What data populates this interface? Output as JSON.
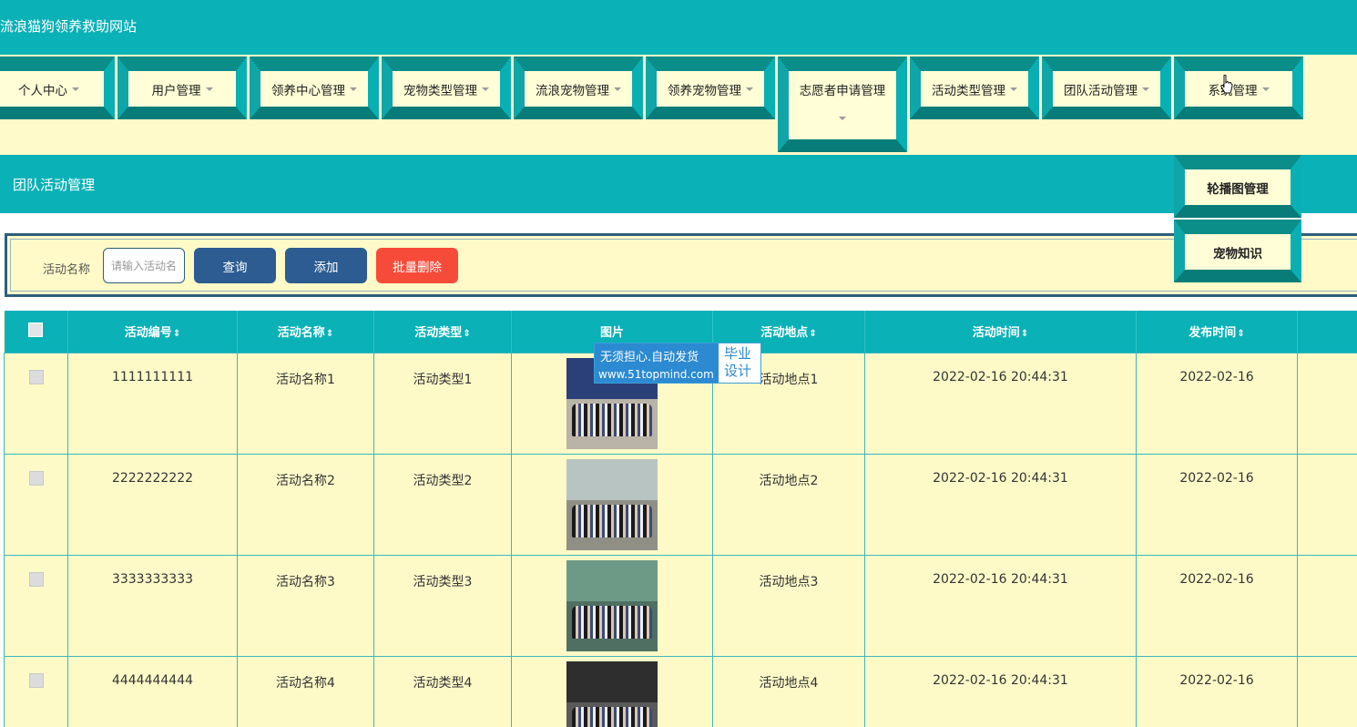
{
  "header": {
    "site_title": "流浪猫狗领养救助网站"
  },
  "nav": {
    "items": [
      {
        "label": "个人中心"
      },
      {
        "label": "用户管理"
      },
      {
        "label": "领养中心管理"
      },
      {
        "label": "宠物类型管理"
      },
      {
        "label": "流浪宠物管理"
      },
      {
        "label": "领养宠物管理"
      },
      {
        "label": "志愿者申请管理"
      },
      {
        "label": "活动类型管理"
      },
      {
        "label": "团队活动管理"
      },
      {
        "label": "系统管理"
      }
    ],
    "dropdown": [
      {
        "label": "轮播图管理"
      },
      {
        "label": "宠物知识"
      }
    ]
  },
  "section": {
    "title": "团队活动管理"
  },
  "search": {
    "label": "活动名称",
    "placeholder": "请输入活动名称",
    "query_button": "查询",
    "add_button": "添加",
    "batch_delete_button": "批量删除"
  },
  "table": {
    "headers": [
      "活动编号",
      "活动名称",
      "活动类型",
      "图片",
      "活动地点",
      "活动时间",
      "发布时间"
    ],
    "sort_glyph": "⇕",
    "rows": [
      {
        "id": "1111111111",
        "name": "活动名称1",
        "type": "活动类型1",
        "location": "活动地点1",
        "time": "2022-02-16 20:44:31",
        "published": "2022-02-16"
      },
      {
        "id": "2222222222",
        "name": "活动名称2",
        "type": "活动类型2",
        "location": "活动地点2",
        "time": "2022-02-16 20:44:31",
        "published": "2022-02-16"
      },
      {
        "id": "3333333333",
        "name": "活动名称3",
        "type": "活动类型3",
        "location": "活动地点3",
        "time": "2022-02-16 20:44:31",
        "published": "2022-02-16"
      },
      {
        "id": "4444444444",
        "name": "活动名称4",
        "type": "活动类型4",
        "location": "活动地点4",
        "time": "2022-02-16 20:44:31",
        "published": "2022-02-16"
      }
    ]
  },
  "watermark": {
    "line1": "无须担心.自动发货",
    "line2": "www.51topmind.com",
    "right_line1": "毕业",
    "right_line2": "设计"
  },
  "colors": {
    "teal": "#0ab1b7",
    "cream": "#fefac8",
    "blue_button": "#2c5c91",
    "red_button": "#f74b3a"
  }
}
